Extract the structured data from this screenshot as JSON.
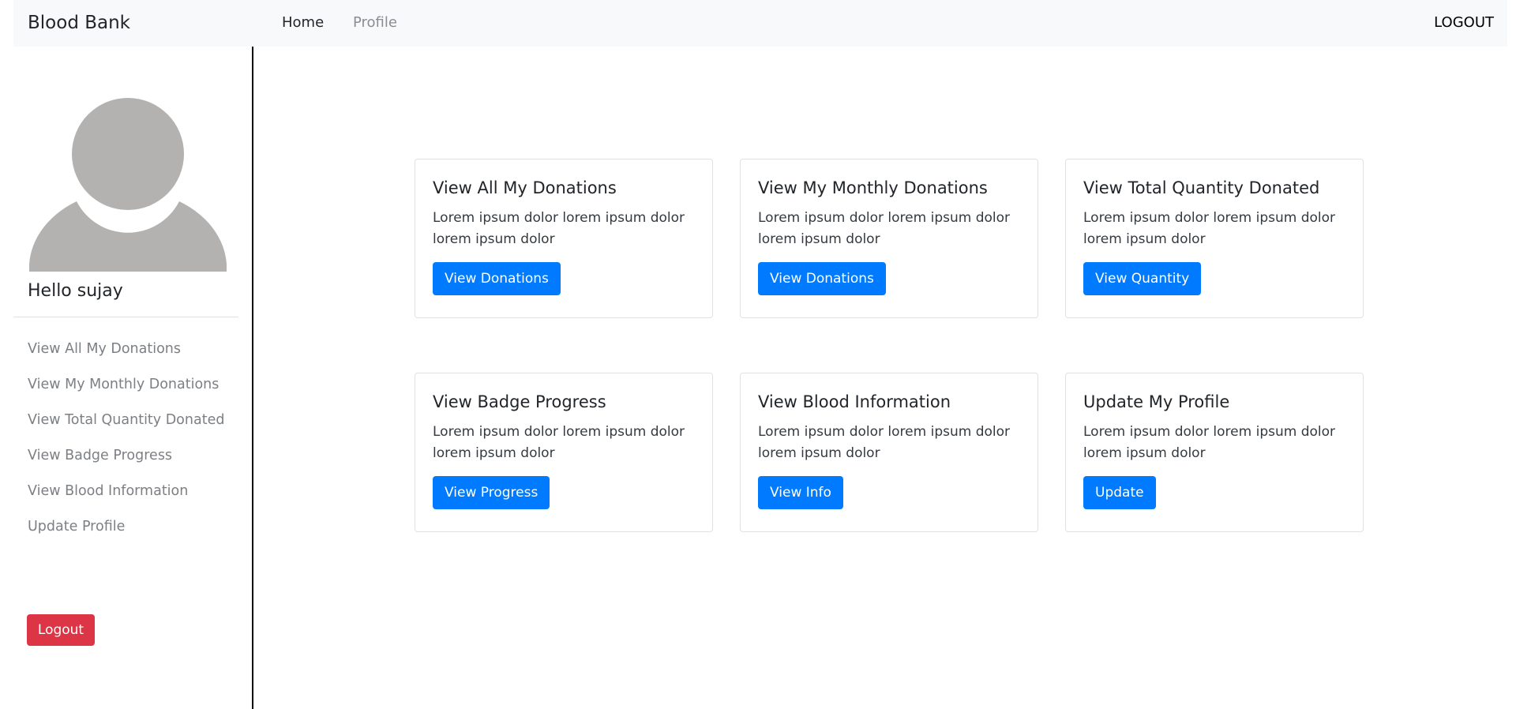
{
  "navbar": {
    "brand": "Blood Bank",
    "links": [
      {
        "label": "Home"
      },
      {
        "label": "Profile"
      }
    ],
    "logout": "LOGOUT"
  },
  "sidebar": {
    "greeting": "Hello sujay",
    "items": [
      {
        "label": "View All My Donations"
      },
      {
        "label": "View My Monthly Donations"
      },
      {
        "label": "View Total Quantity Donated"
      },
      {
        "label": "View Badge Progress"
      },
      {
        "label": "View Blood Information"
      },
      {
        "label": "Update Profile"
      }
    ],
    "logout_label": "Logout"
  },
  "cards": [
    {
      "title": "View All My Donations",
      "text": "Lorem ipsum dolor lorem ipsum dolor lorem ipsum dolor",
      "button": "View Donations"
    },
    {
      "title": "View My Monthly Donations",
      "text": "Lorem ipsum dolor lorem ipsum dolor lorem ipsum dolor",
      "button": "View Donations"
    },
    {
      "title": "View Total Quantity Donated",
      "text": "Lorem ipsum dolor lorem ipsum dolor lorem ipsum dolor",
      "button": "View Quantity"
    },
    {
      "title": "View Badge Progress",
      "text": "Lorem ipsum dolor lorem ipsum dolor lorem ipsum dolor",
      "button": "View Progress"
    },
    {
      "title": "View Blood Information",
      "text": "Lorem ipsum dolor lorem ipsum dolor lorem ipsum dolor",
      "button": "View Info"
    },
    {
      "title": "Update My Profile",
      "text": "Lorem ipsum dolor lorem ipsum dolor lorem ipsum dolor",
      "button": "Update"
    }
  ],
  "colors": {
    "primary": "#007bff",
    "danger": "#dc3545",
    "navbar_bg": "#f8f9fa",
    "avatar_gray": "#b3b2b1"
  },
  "icons": {
    "avatar": "user-avatar-icon"
  }
}
